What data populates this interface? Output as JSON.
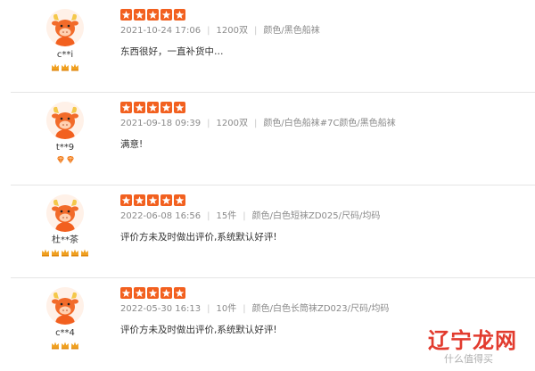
{
  "reviews": [
    {
      "username": "c**i",
      "rating": 5,
      "badge_type": "crown",
      "badge_count": 3,
      "date": "2021-10-24 17:06",
      "quantity": "1200双",
      "variant": "颜色/黑色船袜",
      "text": "东西很好，一直补货中…"
    },
    {
      "username": "t**9",
      "rating": 5,
      "badge_type": "diamond",
      "badge_count": 2,
      "date": "2021-09-18 09:39",
      "quantity": "1200双",
      "variant": "颜色/白色船袜#7C颜色/黑色船袜",
      "text": "满意!"
    },
    {
      "username": "杜**茶",
      "rating": 5,
      "badge_type": "crown",
      "badge_count": 5,
      "date": "2022-06-08 16:56",
      "quantity": "15件",
      "variant": "颜色/白色短袜ZD025/尺码/均码",
      "text": "评价方未及时做出评价,系统默认好评!"
    },
    {
      "username": "c**4",
      "rating": 5,
      "badge_type": "crown",
      "badge_count": 3,
      "date": "2022-05-30 16:13",
      "quantity": "10件",
      "variant": "颜色/白色长筒袜ZD023/尺码/均码",
      "text": "评价方未及时做出评价,系统默认好评!"
    }
  ],
  "watermark": {
    "logo": "辽宁龙网",
    "sub": "什么值得买"
  },
  "colors": {
    "star": "#f2601f",
    "badge_crown": "#f0a020",
    "badge_diamond": "#f07a1e",
    "avatar_face": "#f26b2a"
  }
}
